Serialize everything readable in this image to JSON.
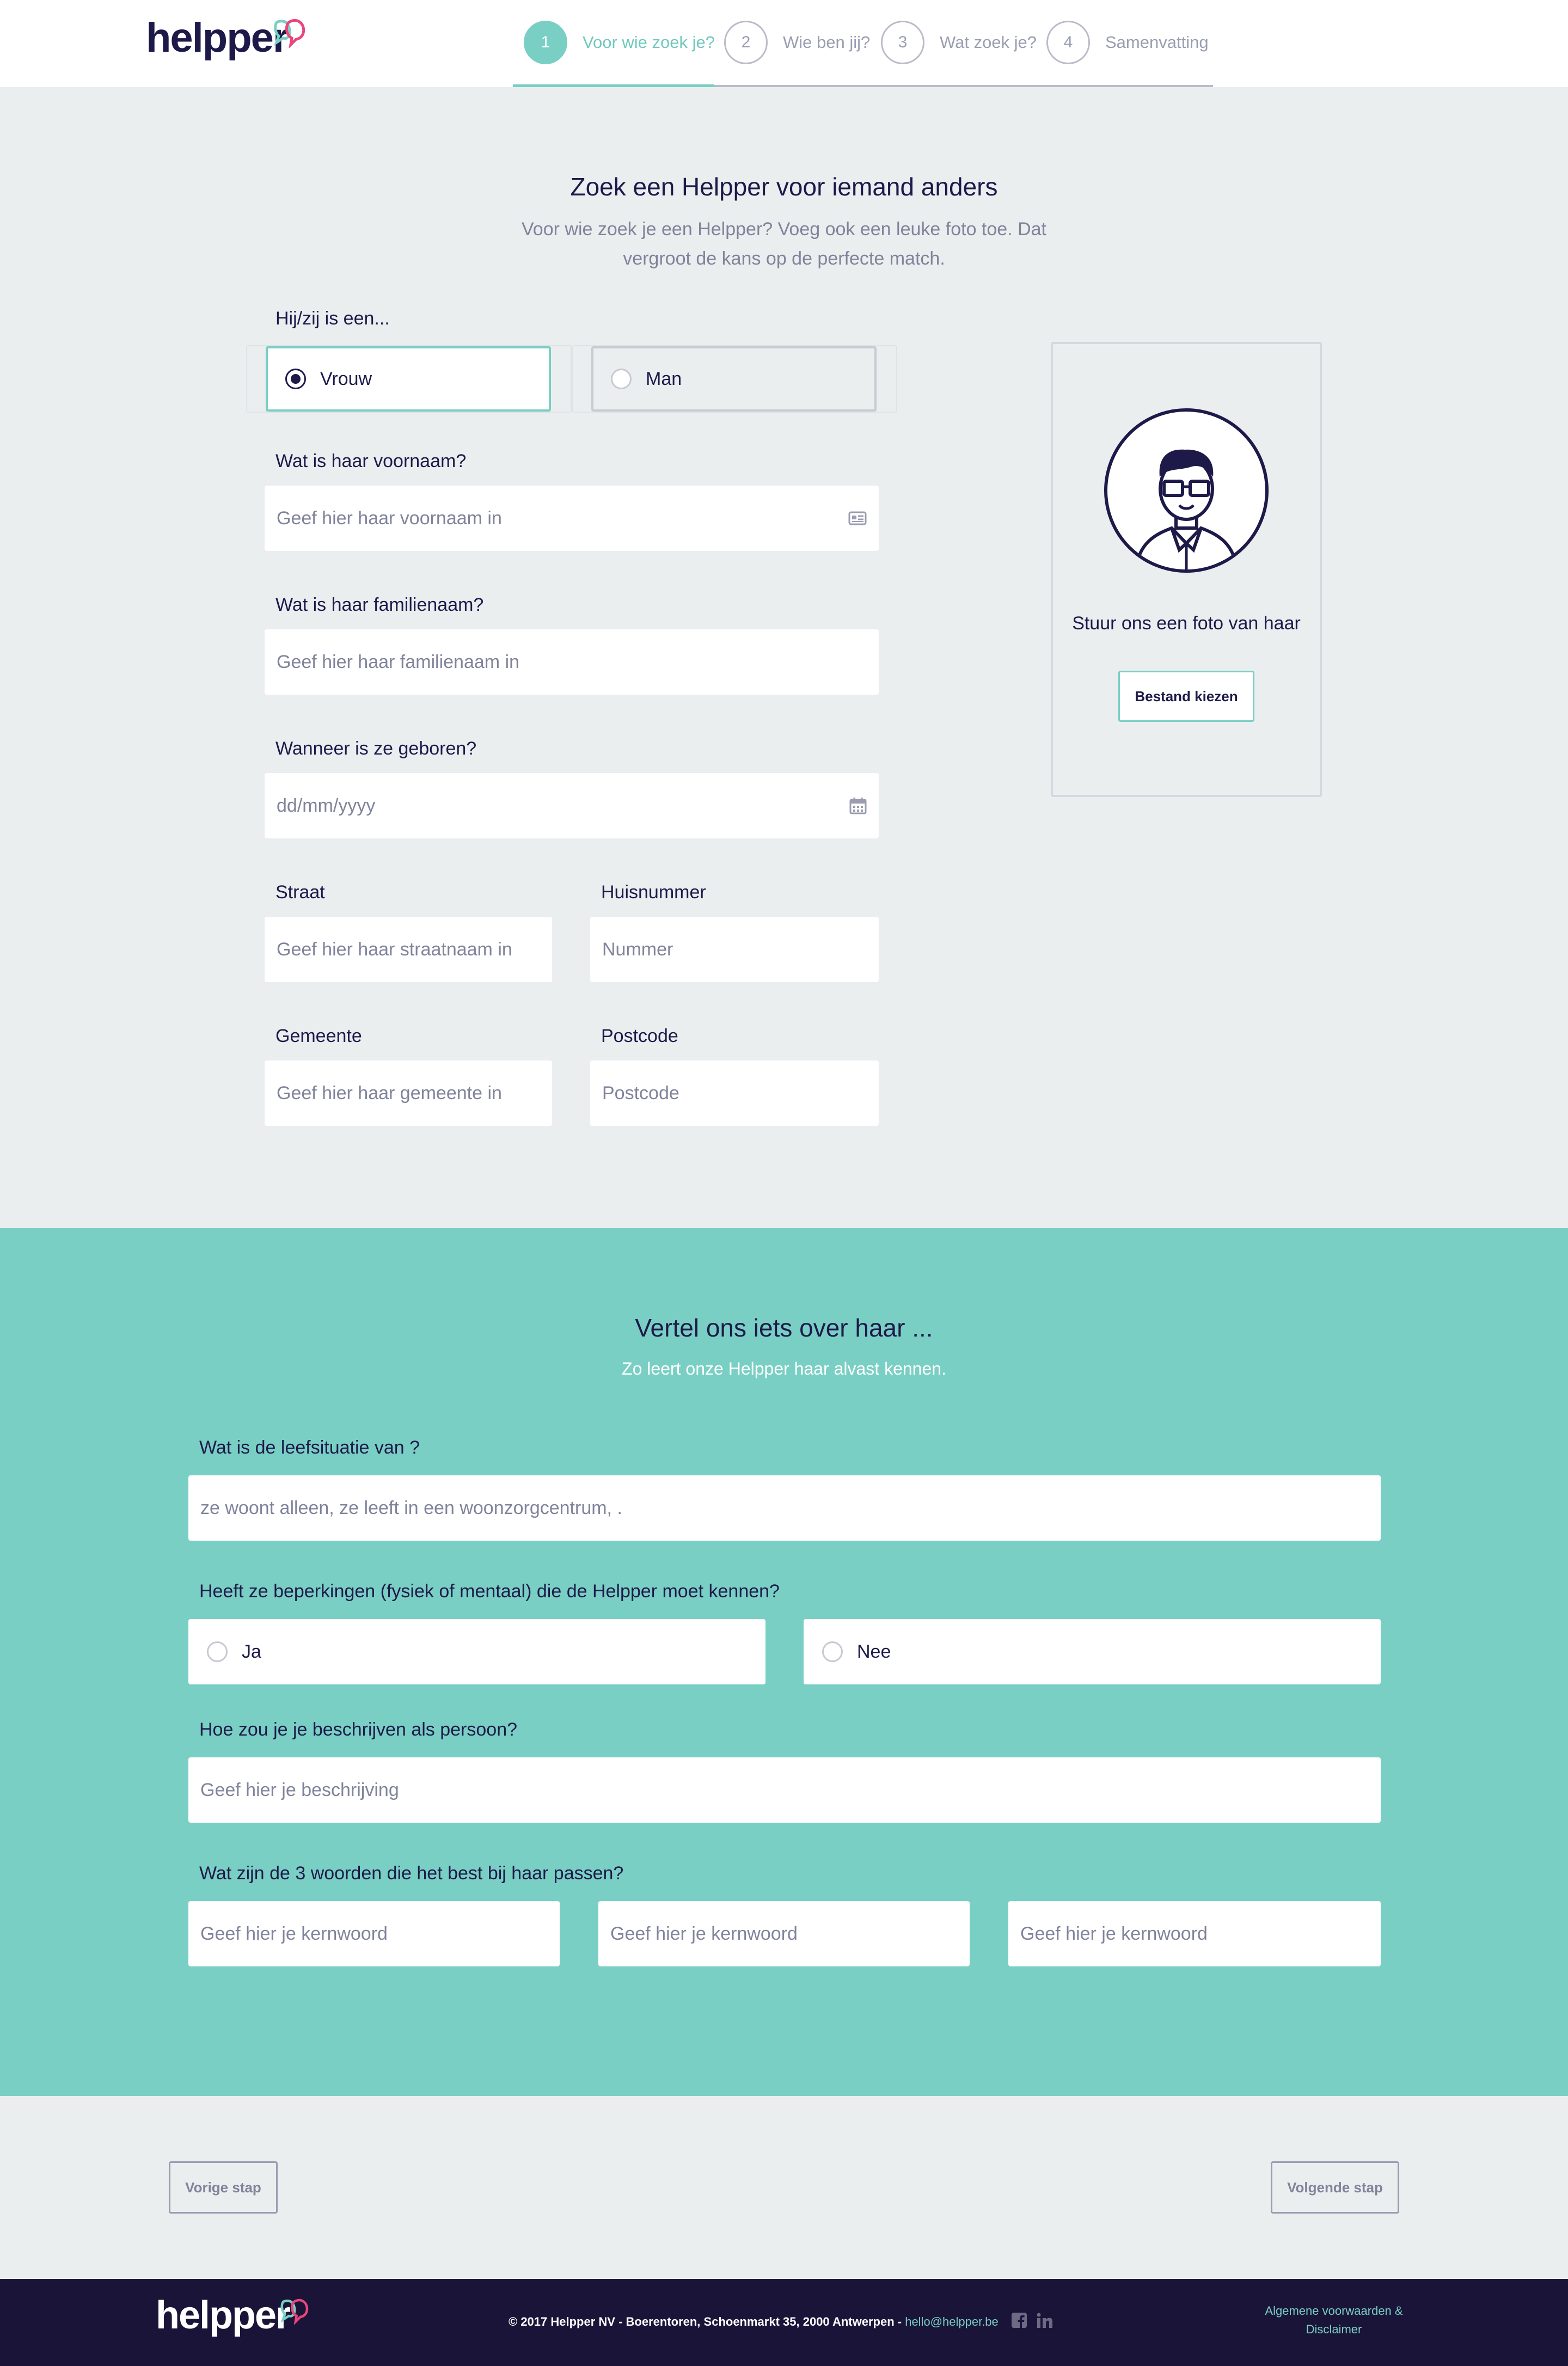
{
  "colors": {
    "accent": "#7acfc4",
    "navy": "#1d1a4a",
    "brand_pink": "#e8467c",
    "page_bg": "#ebeeef",
    "footer_bg": "#1a1438"
  },
  "header": {
    "logo_text": "helpper",
    "steps": [
      {
        "number": "1",
        "label": "Voor wie zoek je?",
        "active": true
      },
      {
        "number": "2",
        "label": "Wie ben jij?",
        "active": false
      },
      {
        "number": "3",
        "label": "Wat zoek je?",
        "active": false
      },
      {
        "number": "4",
        "label": "Samenvatting",
        "active": false
      }
    ]
  },
  "intro": {
    "title": "Zoek een Helpper voor iemand anders",
    "subtitle_line1": "Voor wie zoek je een Helpper? Voeg ook een leuke foto toe. Dat",
    "subtitle_line2": "vergroot de kans op de perfecte match."
  },
  "form": {
    "gender_label": "Hij/zij is een...",
    "gender_options": [
      {
        "label": "Vrouw",
        "checked": true
      },
      {
        "label": "Man",
        "checked": false
      }
    ],
    "firstname_label": "Wat is haar voornaam?",
    "firstname_placeholder": "Geef hier haar voornaam in",
    "lastname_label": "Wat is haar familienaam?",
    "lastname_placeholder": "Geef hier haar familienaam in",
    "birthdate_label": "Wanneer is ze geboren?",
    "birthdate_placeholder": "dd/mm/yyyy",
    "street_label": "Straat",
    "street_placeholder": "Geef hier haar straatnaam in",
    "number_label": "Huisnummer",
    "number_placeholder": "Nummer",
    "city_label": "Gemeente",
    "city_placeholder": "Geef hier haar gemeente in",
    "zip_label": "Postcode",
    "zip_placeholder": "Postcode"
  },
  "photo": {
    "icon": "avatar-illustration-icon",
    "caption": "Stuur ons een foto van haar",
    "button_label": "Bestand kiezen"
  },
  "about": {
    "title": "Vertel ons iets over haar ...",
    "subtitle": "Zo leert onze Helpper haar alvast kennen.",
    "living_label": "Wat is de leefsituatie van ?",
    "living_placeholder": "ze woont alleen, ze leeft in een woonzorgcentrum, .",
    "limits_label": "Heeft ze beperkingen (fysiek of mentaal) die de Helpper moet kennen?",
    "limits_options": [
      {
        "label": "Ja",
        "checked": false
      },
      {
        "label": "Nee",
        "checked": false
      }
    ],
    "describe_label": "Hoe zou je je beschrijven als persoon?",
    "describe_placeholder": "Geef hier je beschrijving",
    "keywords_label": "Wat zijn de 3 woorden die het best bij haar passen?",
    "keyword_placeholder": "Geef hier je kernwoord"
  },
  "nav": {
    "prev_label": "Vorige stap",
    "next_label": "Volgende stap"
  },
  "footer": {
    "logo_text": "helpper",
    "copyright": "© 2017 Helpper NV  -  Boerentoren, Schoenmarkt 35, 2000 Antwerpen  -",
    "email": "hello@helpper.be",
    "social_icons": [
      "facebook-icon",
      "linkedin-icon"
    ],
    "terms_line1": "Algemene voorwaarden &",
    "terms_line2": "Disclaimer"
  }
}
